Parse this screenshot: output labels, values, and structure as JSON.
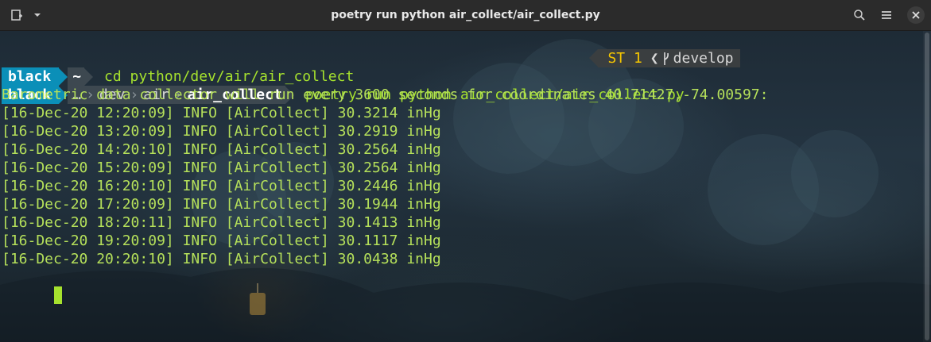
{
  "window": {
    "title": "poetry run python air_collect/air_collect.py",
    "left_icons": [
      "new-tab-icon",
      "chevron-down-icon"
    ],
    "right_icons": [
      "search-icon",
      "hamburger-menu-icon",
      "close-icon"
    ]
  },
  "prompts": [
    {
      "host": "black",
      "dir_segments": [
        "~"
      ],
      "command": "cd python/dev/air/air_collect"
    },
    {
      "host": "black",
      "dir_segments": [
        "…",
        "dev",
        "air",
        "air_collect"
      ],
      "command": "poetry run python air_collect/air_collect.py",
      "right": {
        "status": "ST 1",
        "branch": "develop"
      }
    }
  ],
  "output": {
    "header": "Barometric data collector will run every 3600 seconds for coordinates 40.71427,-74.00597:",
    "log_lines": [
      "[16-Dec-20 12:20:09] INFO [AirCollect] 30.3214 inHg",
      "[16-Dec-20 13:20:09] INFO [AirCollect] 30.2919 inHg",
      "[16-Dec-20 14:20:10] INFO [AirCollect] 30.2564 inHg",
      "[16-Dec-20 15:20:09] INFO [AirCollect] 30.2564 inHg",
      "[16-Dec-20 16:20:10] INFO [AirCollect] 30.2446 inHg",
      "[16-Dec-20 17:20:09] INFO [AirCollect] 30.1944 inHg",
      "[16-Dec-20 18:20:11] INFO [AirCollect] 30.1413 inHg",
      "[16-Dec-20 19:20:09] INFO [AirCollect] 30.1117 inHg",
      "[16-Dec-20 20:20:10] INFO [AirCollect] 30.0438 inHg"
    ]
  },
  "colors": {
    "prompt_host_bg": "#0b8fb8",
    "dir_bg": "#3d4850",
    "text_green": "#a6e22e",
    "status_yellow": "#f6c700"
  }
}
